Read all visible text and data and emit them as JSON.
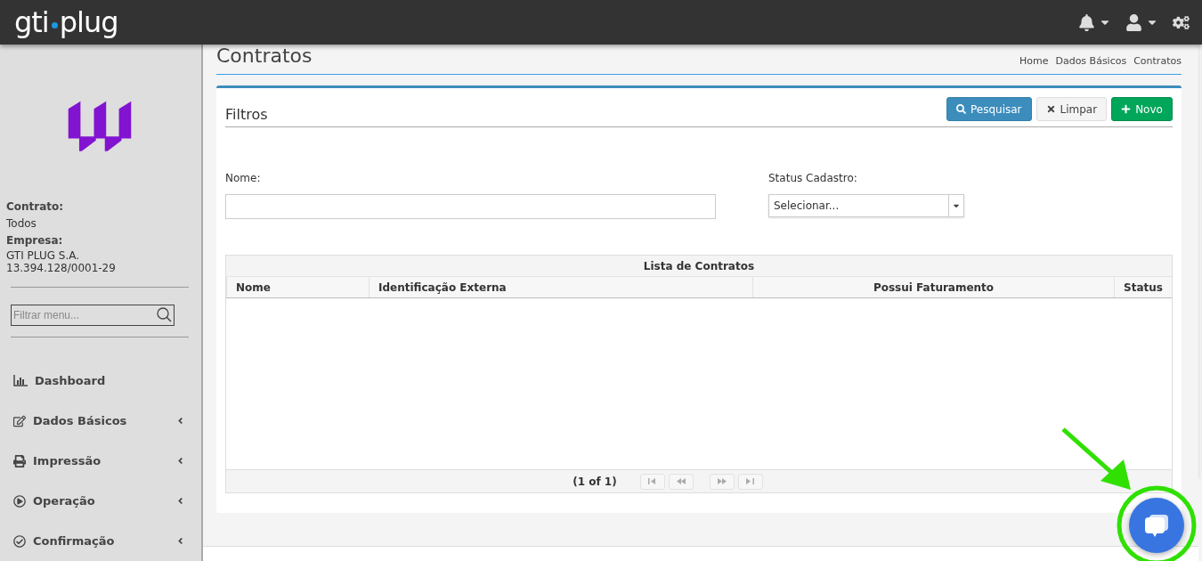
{
  "topbar": {
    "logo_left": "gti",
    "logo_right": "plug",
    "icons": [
      {
        "kind": "bell",
        "dropdown": true
      },
      {
        "kind": "user",
        "dropdown": true
      },
      {
        "kind": "gears",
        "dropdown": false
      }
    ]
  },
  "sidebar": {
    "contract_label": "Contrato:",
    "contract_value": "Todos",
    "company_label": "Empresa:",
    "company_name": "GTI PLUG S.A.",
    "company_id": "13.394.128/0001-29",
    "filter": {
      "placeholder": "Filtrar menu..."
    },
    "items": [
      {
        "kind": "chart",
        "label": "Dashboard",
        "expandable": false
      },
      {
        "kind": "edit",
        "label": "Dados Básicos",
        "expandable": true
      },
      {
        "kind": "print",
        "label": "Impressão",
        "expandable": true
      },
      {
        "kind": "play",
        "label": "Operação",
        "expandable": true
      },
      {
        "kind": "check",
        "label": "Confirmação",
        "expandable": true
      }
    ]
  },
  "page": {
    "title": "Contratos",
    "breadcrumb": [
      "Home",
      "Dados Básicos",
      "Contratos"
    ]
  },
  "filters": {
    "title": "Filtros",
    "buttons": [
      {
        "kind": "search",
        "label": "Pesquisar"
      },
      {
        "kind": "clear",
        "label": "Limpar"
      },
      {
        "kind": "new",
        "label": "Novo"
      }
    ],
    "name_label": "Nome:",
    "status_label": "Status Cadastro:",
    "status_select": {
      "placeholder": "Selecionar..."
    }
  },
  "table": {
    "caption": "Lista de Contratos",
    "columns": [
      {
        "label": "Nome"
      },
      {
        "label": "Identificação Externa"
      },
      {
        "label": "Possui Faturamento"
      },
      {
        "label": "Status"
      }
    ],
    "page_report": "(1 of 1)",
    "pager": [
      {
        "kind": "first",
        "disabled": true
      },
      {
        "kind": "prev",
        "disabled": true
      },
      {
        "kind": "next",
        "disabled": true
      },
      {
        "kind": "last",
        "disabled": true
      }
    ]
  }
}
